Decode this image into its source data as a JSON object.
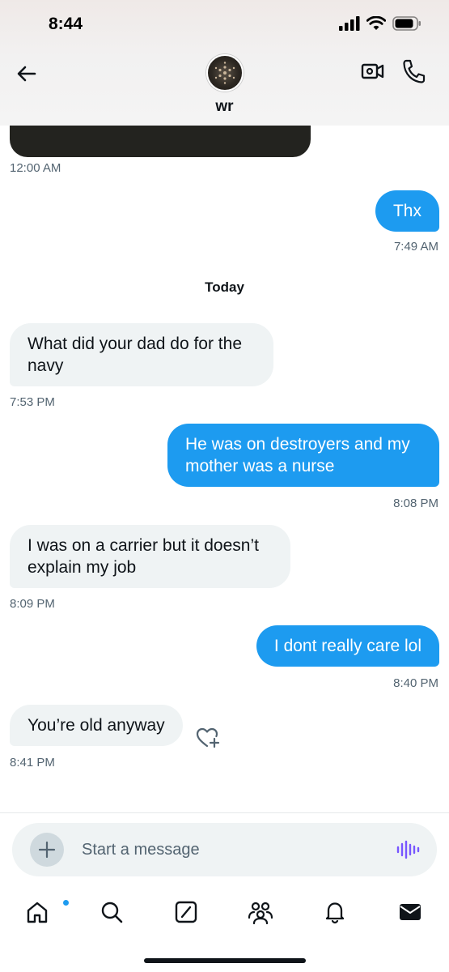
{
  "status_bar": {
    "time": "8:44"
  },
  "header": {
    "contact_name": "wr"
  },
  "colors": {
    "accent": "#1d9bf0",
    "incoming_bubble": "#eff3f4",
    "muted_text": "#536471",
    "voice_icon": "#7856ff"
  },
  "conversation": {
    "media_timestamp": "12:00 AM",
    "day_separator": "Today",
    "messages": [
      {
        "direction": "out",
        "text": "Thx",
        "time": "7:49 AM"
      },
      {
        "direction": "in",
        "text": "What did your dad do for the navy",
        "time": "7:53 PM"
      },
      {
        "direction": "out",
        "text": "He was on destroyers and my mother was a nurse",
        "time": "8:08 PM"
      },
      {
        "direction": "in",
        "text": "I was on a carrier but it doesn’t explain my job",
        "time": "8:09 PM"
      },
      {
        "direction": "out",
        "text": "I dont really care lol",
        "time": "8:40 PM"
      },
      {
        "direction": "in",
        "text": "You’re old anyway",
        "time": "8:41 PM"
      }
    ]
  },
  "composer": {
    "placeholder": "Start a message",
    "value": ""
  },
  "nav": {
    "items": [
      {
        "icon": "home-icon",
        "active": true,
        "notification_dot": true
      },
      {
        "icon": "search-icon"
      },
      {
        "icon": "compose-icon"
      },
      {
        "icon": "communities-icon"
      },
      {
        "icon": "notifications-icon"
      },
      {
        "icon": "messages-icon"
      }
    ]
  }
}
